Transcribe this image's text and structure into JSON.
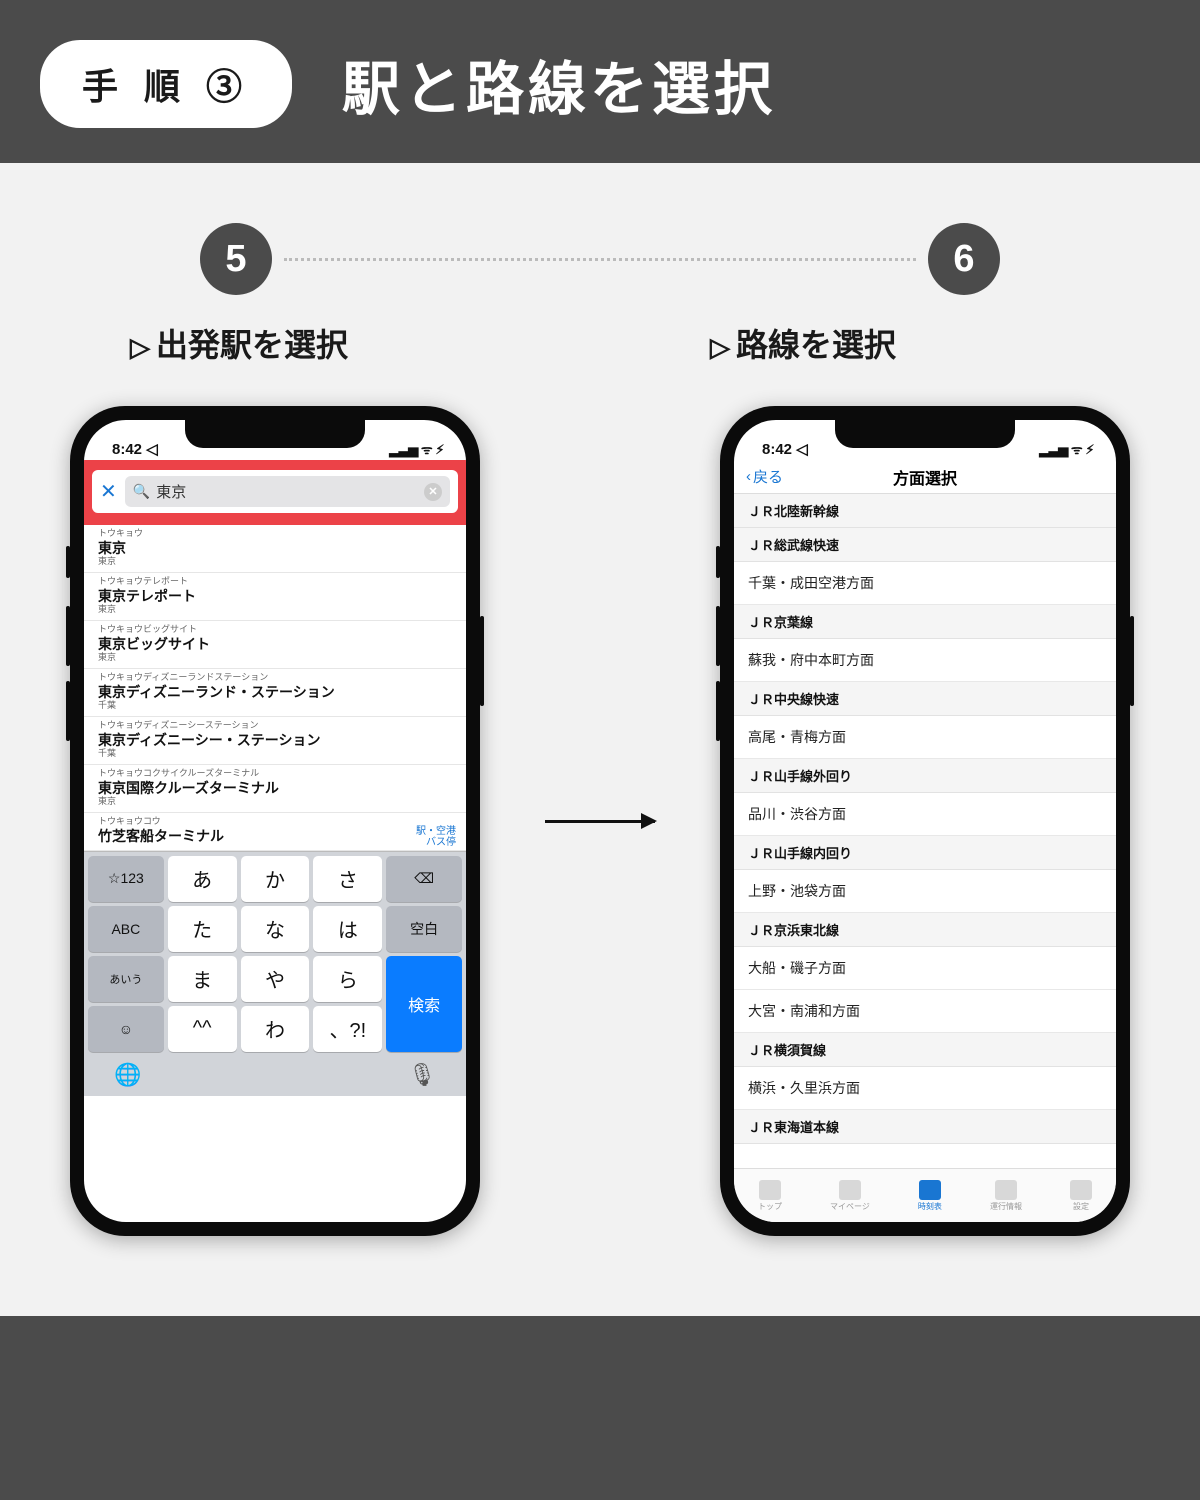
{
  "header": {
    "badge": "手 順 ③",
    "title": "駅と路線を選択"
  },
  "steps": {
    "a": "5",
    "b": "6"
  },
  "labels": {
    "a": "出発駅を選択",
    "b": "路線を選択"
  },
  "status": {
    "time": "8:42",
    "loc": "◁",
    "right": "▂▃▅ ᯤ ⚡︎"
  },
  "search": {
    "close": "✕",
    "icon": "🔍",
    "value": "東京",
    "clear": "✕"
  },
  "results": [
    {
      "kana": "トウキョウ",
      "name": "東京",
      "pref": "東京"
    },
    {
      "kana": "トウキョウテレポート",
      "name": "東京テレポート",
      "pref": "東京"
    },
    {
      "kana": "トウキョウビッグサイト",
      "name": "東京ビッグサイト",
      "pref": "東京"
    },
    {
      "kana": "トウキョウディズニーランドステーション",
      "name": "東京ディズニーランド・ステーション",
      "pref": "千葉"
    },
    {
      "kana": "トウキョウディズニーシーステーション",
      "name": "東京ディズニーシー・ステーション",
      "pref": "千葉"
    },
    {
      "kana": "トウキョウコクサイクルーズターミナル",
      "name": "東京国際クルーズターミナル",
      "pref": "東京"
    },
    {
      "kana": "トウキョウコウ",
      "name": "竹芝客船ターミナル",
      "pref": "",
      "tag1": "駅・空港",
      "tag2": "バス停"
    }
  ],
  "keyboard": {
    "r1": [
      "☆123",
      "あ",
      "か",
      "さ",
      "⌫"
    ],
    "r2": [
      "ABC",
      "た",
      "な",
      "は",
      "空白"
    ],
    "r3": [
      "あいう",
      "ま",
      "や",
      "ら"
    ],
    "r4": [
      "☺",
      "^^",
      "わ",
      "、?!"
    ],
    "search": "検索",
    "globe": "🌐",
    "mic": "🎙"
  },
  "nav": {
    "back": "戻る",
    "title": "方面選択"
  },
  "routes": [
    {
      "type": "head",
      "text": "ＪＲ北陸新幹線"
    },
    {
      "type": "head",
      "text": "ＪＲ総武線快速"
    },
    {
      "type": "item",
      "text": "千葉・成田空港方面"
    },
    {
      "type": "head",
      "text": "ＪＲ京葉線"
    },
    {
      "type": "item",
      "text": "蘇我・府中本町方面"
    },
    {
      "type": "head",
      "text": "ＪＲ中央線快速"
    },
    {
      "type": "item",
      "text": "高尾・青梅方面"
    },
    {
      "type": "head",
      "text": "ＪＲ山手線外回り"
    },
    {
      "type": "item",
      "text": "品川・渋谷方面"
    },
    {
      "type": "head",
      "text": "ＪＲ山手線内回り"
    },
    {
      "type": "item",
      "text": "上野・池袋方面"
    },
    {
      "type": "head",
      "text": "ＪＲ京浜東北線"
    },
    {
      "type": "item",
      "text": "大船・磯子方面"
    },
    {
      "type": "item",
      "text": "大宮・南浦和方面"
    },
    {
      "type": "head",
      "text": "ＪＲ横須賀線"
    },
    {
      "type": "item",
      "text": "横浜・久里浜方面"
    },
    {
      "type": "head",
      "text": "ＪＲ東海道本線"
    }
  ],
  "tabs": [
    "トップ",
    "マイページ",
    "時刻表",
    "運行情報",
    "設定"
  ]
}
